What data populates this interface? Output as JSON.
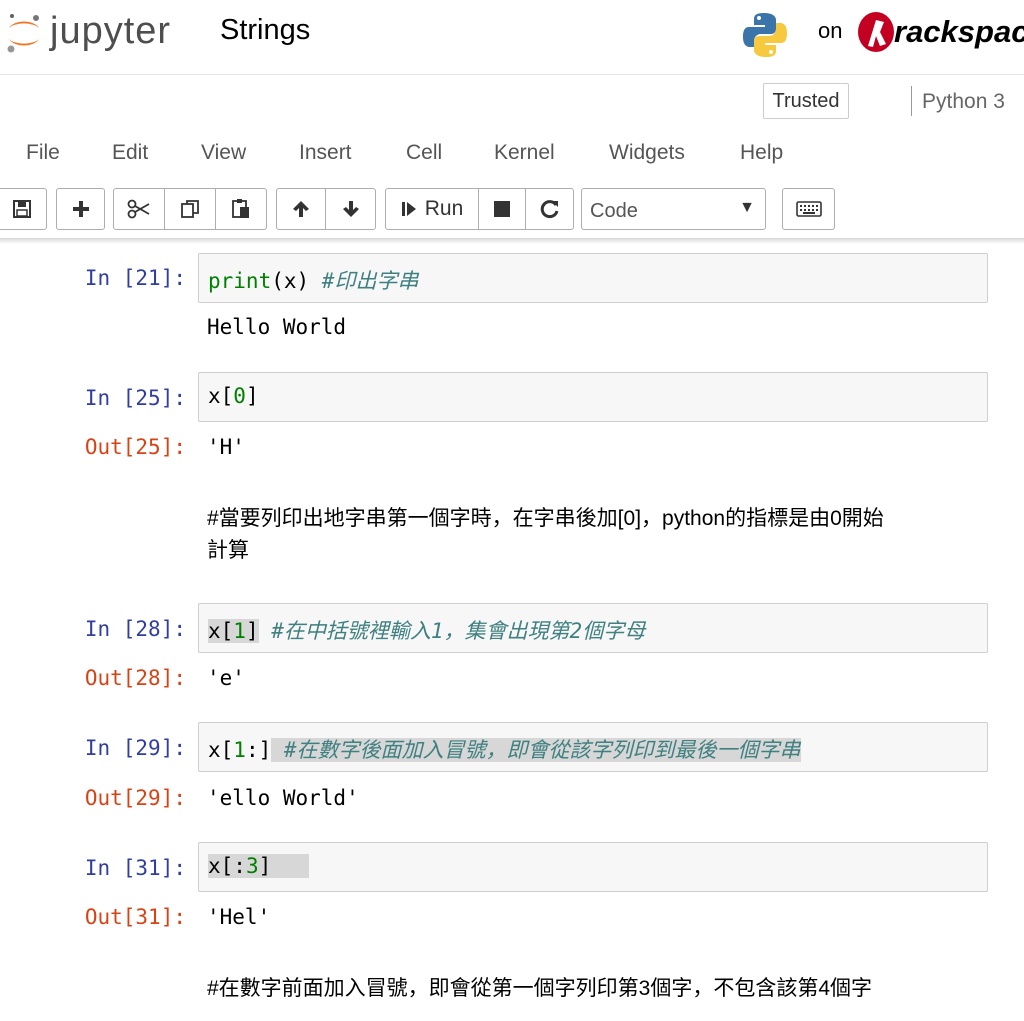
{
  "header": {
    "app_name": "jupyter",
    "notebook_title": "Strings",
    "on_label": "on",
    "hosting_brand": "rackspac",
    "icons": [
      "jupyter-logo",
      "python-logo",
      "rackspace-logo"
    ]
  },
  "status": {
    "trusted_label": "Trusted",
    "kernel_name": "Python 3"
  },
  "menu": {
    "items": [
      "File",
      "Edit",
      "View",
      "Insert",
      "Cell",
      "Kernel",
      "Widgets",
      "Help"
    ]
  },
  "toolbar": {
    "run_label": "Run",
    "cell_type": "Code",
    "icons": [
      "save-icon",
      "plus-icon",
      "scissors-icon",
      "copy-icon",
      "paste-icon",
      "arrow-up-icon",
      "arrow-down-icon",
      "run-icon",
      "stop-icon",
      "restart-icon",
      "keyboard-icon"
    ]
  },
  "cells": {
    "c21": {
      "prompt": "In [21]:",
      "code_func": "print",
      "code_args": "(x) ",
      "code_comment": "#印出字串",
      "output": "Hello World"
    },
    "c25": {
      "prompt": "In [25]:",
      "code_pre": "x[",
      "code_num": "0",
      "code_post": "]",
      "out_prompt": "Out[25]:",
      "output": "'H'"
    },
    "md1": {
      "line1": "#當要列印出地字串第一個字時，在字串後加[0]，python的指標是由0開始",
      "line2": "計算"
    },
    "c28": {
      "prompt": "In [28]:",
      "code_pre": "x[",
      "code_num": "1",
      "code_post": "]",
      "code_comment": "#在中括號裡輸入1，集會出現第2個字母",
      "out_prompt": "Out[28]:",
      "output": "'e'"
    },
    "c29": {
      "prompt": "In [29]:",
      "code_pre": "x[",
      "code_num": "1",
      "code_post": ":]",
      "code_comment": "#在數字後面加入冒號，即會從該字列印到最後一個字串",
      "out_prompt": "Out[29]:",
      "output": "'ello World'"
    },
    "c31": {
      "prompt": "In [31]:",
      "code_pre": "x[:",
      "code_num": "3",
      "code_post": "]",
      "out_prompt": "Out[31]:",
      "output": "'Hel'"
    },
    "md2": {
      "line1": "#在數字前面加入冒號，即會從第一個字列印第3個字，不包含該第4個字"
    }
  },
  "colors": {
    "in_prompt": "#303f9f",
    "out_prompt": "#d84315",
    "keyword": "#008000",
    "comment": "#408080",
    "jupyter_orange": "#f37726"
  }
}
